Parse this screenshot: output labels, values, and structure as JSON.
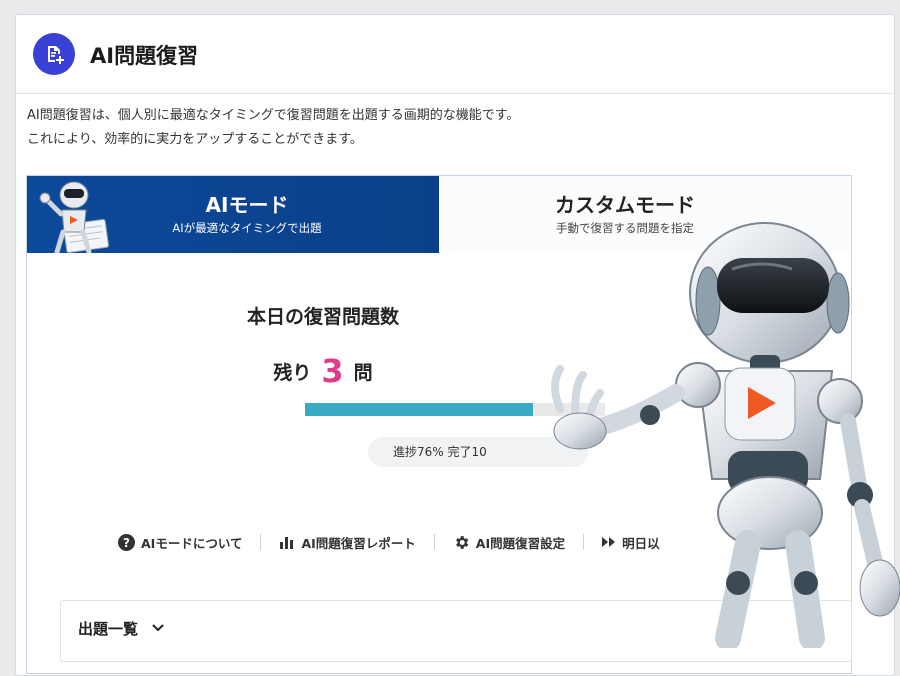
{
  "header": {
    "title": "AI問題復習",
    "icon": "document-add-icon"
  },
  "intro": {
    "line1": "AI問題復習は、個人別に最適なタイミングで復習問題を出題する画期的な機能です。",
    "line2": "これにより、効率的に実力をアップすることができます。"
  },
  "tabs": [
    {
      "title": "AIモード",
      "subtitle": "AIが最適なタイミングで出題",
      "active": true
    },
    {
      "title": "カスタムモード",
      "subtitle": "手動で復習する問題を指定",
      "active": false
    }
  ],
  "today": {
    "title": "本日の復習問題数",
    "remaining_prefix": "残り",
    "remaining_count": "3",
    "remaining_suffix": "問",
    "progress_text": "進捗76%  完了10",
    "progress_percent": 76
  },
  "links": [
    {
      "label": "AIモードについて",
      "icon": "question-circle-icon"
    },
    {
      "label": "AI問題復習レポート",
      "icon": "bar-chart-icon"
    },
    {
      "label": "AI問題復習設定",
      "icon": "gear-icon"
    },
    {
      "label": "明日以",
      "icon": "fast-forward-icon"
    }
  ],
  "question_list": {
    "title": "出題一覧",
    "icon": "chevron-down-icon"
  },
  "colors": {
    "accent_blue": "#0c4a9a",
    "header_icon": "#3a3fd6",
    "count_pink": "#e03c8a",
    "progress": "#3aa9c3",
    "robot_play_orange": "#ef5a24"
  }
}
